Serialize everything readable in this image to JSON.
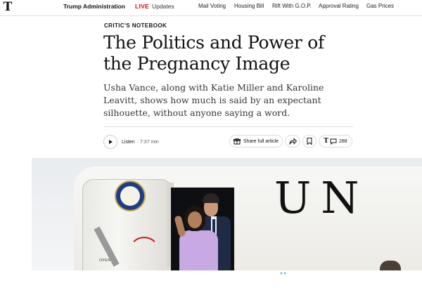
{
  "topnav": {
    "logo_text": "T",
    "section_label": "Trump Administration",
    "live_label": "LIVE",
    "updates_label": "Updates",
    "links": [
      {
        "label": "Mail Voting"
      },
      {
        "label": "Housing Bill"
      },
      {
        "label": "Rift With G.O.P."
      },
      {
        "label": "Approval Rating"
      },
      {
        "label": "Gas Prices"
      }
    ]
  },
  "article": {
    "kicker": "CRITIC'S NOTEBOOK",
    "headline": "The Politics and Power of the Pregnancy Image",
    "dek": "Usha Vance, along with Katie Miller and Karoline Leavitt, shows how much is said by an expectant silhouette, without anyone saying a word."
  },
  "toolbar": {
    "listen_label": "Listen",
    "listen_time": "· 7:37 min",
    "share_full_label": "Share full article",
    "comment_count": "288",
    "icons": [
      "play-icon",
      "gift-icon",
      "share-icon",
      "bookmark-icon",
      "comment-icon"
    ]
  },
  "hero": {
    "plane_lettering": "UN",
    "door_label": "OPEN"
  },
  "colors": {
    "live_red": "#d0021b",
    "text": "#121212",
    "divider": "#e2e2e2"
  }
}
